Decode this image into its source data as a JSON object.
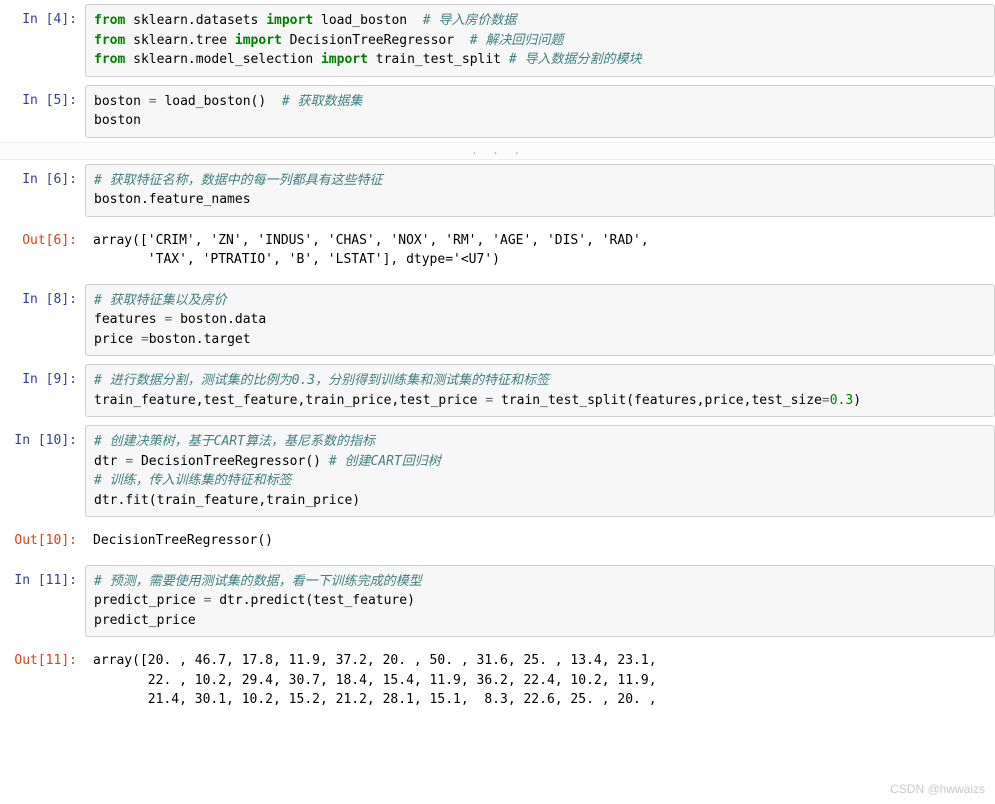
{
  "cells": [
    {
      "in_prompt": "In  [4]:",
      "code": {
        "segments": [
          {
            "t": "from",
            "c": "kw"
          },
          {
            "t": " sklearn.datasets "
          },
          {
            "t": "import",
            "c": "kw"
          },
          {
            "t": " load_boston  "
          },
          {
            "t": "# 导入房价数据",
            "c": "cm"
          },
          {
            "t": "\n"
          },
          {
            "t": "from",
            "c": "kw"
          },
          {
            "t": " sklearn.tree "
          },
          {
            "t": "import",
            "c": "kw"
          },
          {
            "t": " DecisionTreeRegressor  "
          },
          {
            "t": "# 解决回归问题",
            "c": "cm"
          },
          {
            "t": "\n"
          },
          {
            "t": "from",
            "c": "kw"
          },
          {
            "t": " sklearn.model_selection "
          },
          {
            "t": "import",
            "c": "kw"
          },
          {
            "t": " train_test_split "
          },
          {
            "t": "# 导入数据分割的模块",
            "c": "cm"
          }
        ]
      }
    },
    {
      "in_prompt": "In  [5]:",
      "code": {
        "segments": [
          {
            "t": "boston "
          },
          {
            "t": "=",
            "c": "op"
          },
          {
            "t": " load_boston()  "
          },
          {
            "t": "# 获取数据集",
            "c": "cm"
          },
          {
            "t": "\n"
          },
          {
            "t": "boston"
          }
        ]
      },
      "separator_after": true
    },
    {
      "in_prompt": "In  [6]:",
      "code": {
        "segments": [
          {
            "t": "# 获取特征名称，数据中的每一列都具有这些特征",
            "c": "cm"
          },
          {
            "t": "\n"
          },
          {
            "t": "boston.feature_names"
          }
        ]
      },
      "out_prompt": "Out[6]:",
      "output": "array(['CRIM', 'ZN', 'INDUS', 'CHAS', 'NOX', 'RM', 'AGE', 'DIS', 'RAD',\n       'TAX', 'PTRATIO', 'B', 'LSTAT'], dtype='<U7')"
    },
    {
      "in_prompt": "In  [8]:",
      "code": {
        "segments": [
          {
            "t": "# 获取特征集以及房价",
            "c": "cm"
          },
          {
            "t": "\n"
          },
          {
            "t": "features "
          },
          {
            "t": "=",
            "c": "op"
          },
          {
            "t": " boston.data\n"
          },
          {
            "t": "price "
          },
          {
            "t": "=",
            "c": "op"
          },
          {
            "t": "boston.target"
          }
        ]
      }
    },
    {
      "in_prompt": "In  [9]:",
      "code": {
        "segments": [
          {
            "t": "# 进行数据分割，测试集的比例为0.3，分别得到训练集和测试集的特征和标签",
            "c": "cm"
          },
          {
            "t": "\n"
          },
          {
            "t": "train_feature,test_feature,train_price,test_price "
          },
          {
            "t": "=",
            "c": "op"
          },
          {
            "t": " train_test_split(features,price,test_size"
          },
          {
            "t": "=",
            "c": "op"
          },
          {
            "t": "0.3",
            "c": "num"
          },
          {
            "t": ")"
          }
        ]
      }
    },
    {
      "in_prompt": "In [10]:",
      "code": {
        "segments": [
          {
            "t": "# 创建决策树，基于CART算法，基尼系数的指标",
            "c": "cm"
          },
          {
            "t": "\n"
          },
          {
            "t": "dtr "
          },
          {
            "t": "=",
            "c": "op"
          },
          {
            "t": " DecisionTreeRegressor() "
          },
          {
            "t": "# 创建CART回归树",
            "c": "cm"
          },
          {
            "t": "\n"
          },
          {
            "t": "# 训练，传入训练集的特征和标签",
            "c": "cm"
          },
          {
            "t": "\n"
          },
          {
            "t": "dtr.fit(train_feature,train_price)"
          }
        ]
      },
      "out_prompt": "Out[10]:",
      "output": "DecisionTreeRegressor()"
    },
    {
      "in_prompt": "In [11]:",
      "code": {
        "segments": [
          {
            "t": "# 预测，需要使用测试集的数据，看一下训练完成的模型",
            "c": "cm"
          },
          {
            "t": "\n"
          },
          {
            "t": "predict_price "
          },
          {
            "t": "=",
            "c": "op"
          },
          {
            "t": " dtr.predict(test_feature)\n"
          },
          {
            "t": "predict_price"
          }
        ]
      },
      "out_prompt": "Out[11]:",
      "output": "array([20. , 46.7, 17.8, 11.9, 37.2, 20. , 50. , 31.6, 25. , 13.4, 23.1,\n       22. , 10.2, 29.4, 30.7, 18.4, 15.4, 11.9, 36.2, 22.4, 10.2, 11.9,\n       21.4, 30.1, 10.2, 15.2, 21.2, 28.1, 15.1,  8.3, 22.6, 25. , 20. ,"
    }
  ],
  "separator_dots": ". . .",
  "watermark": "CSDN @hwwaizs"
}
